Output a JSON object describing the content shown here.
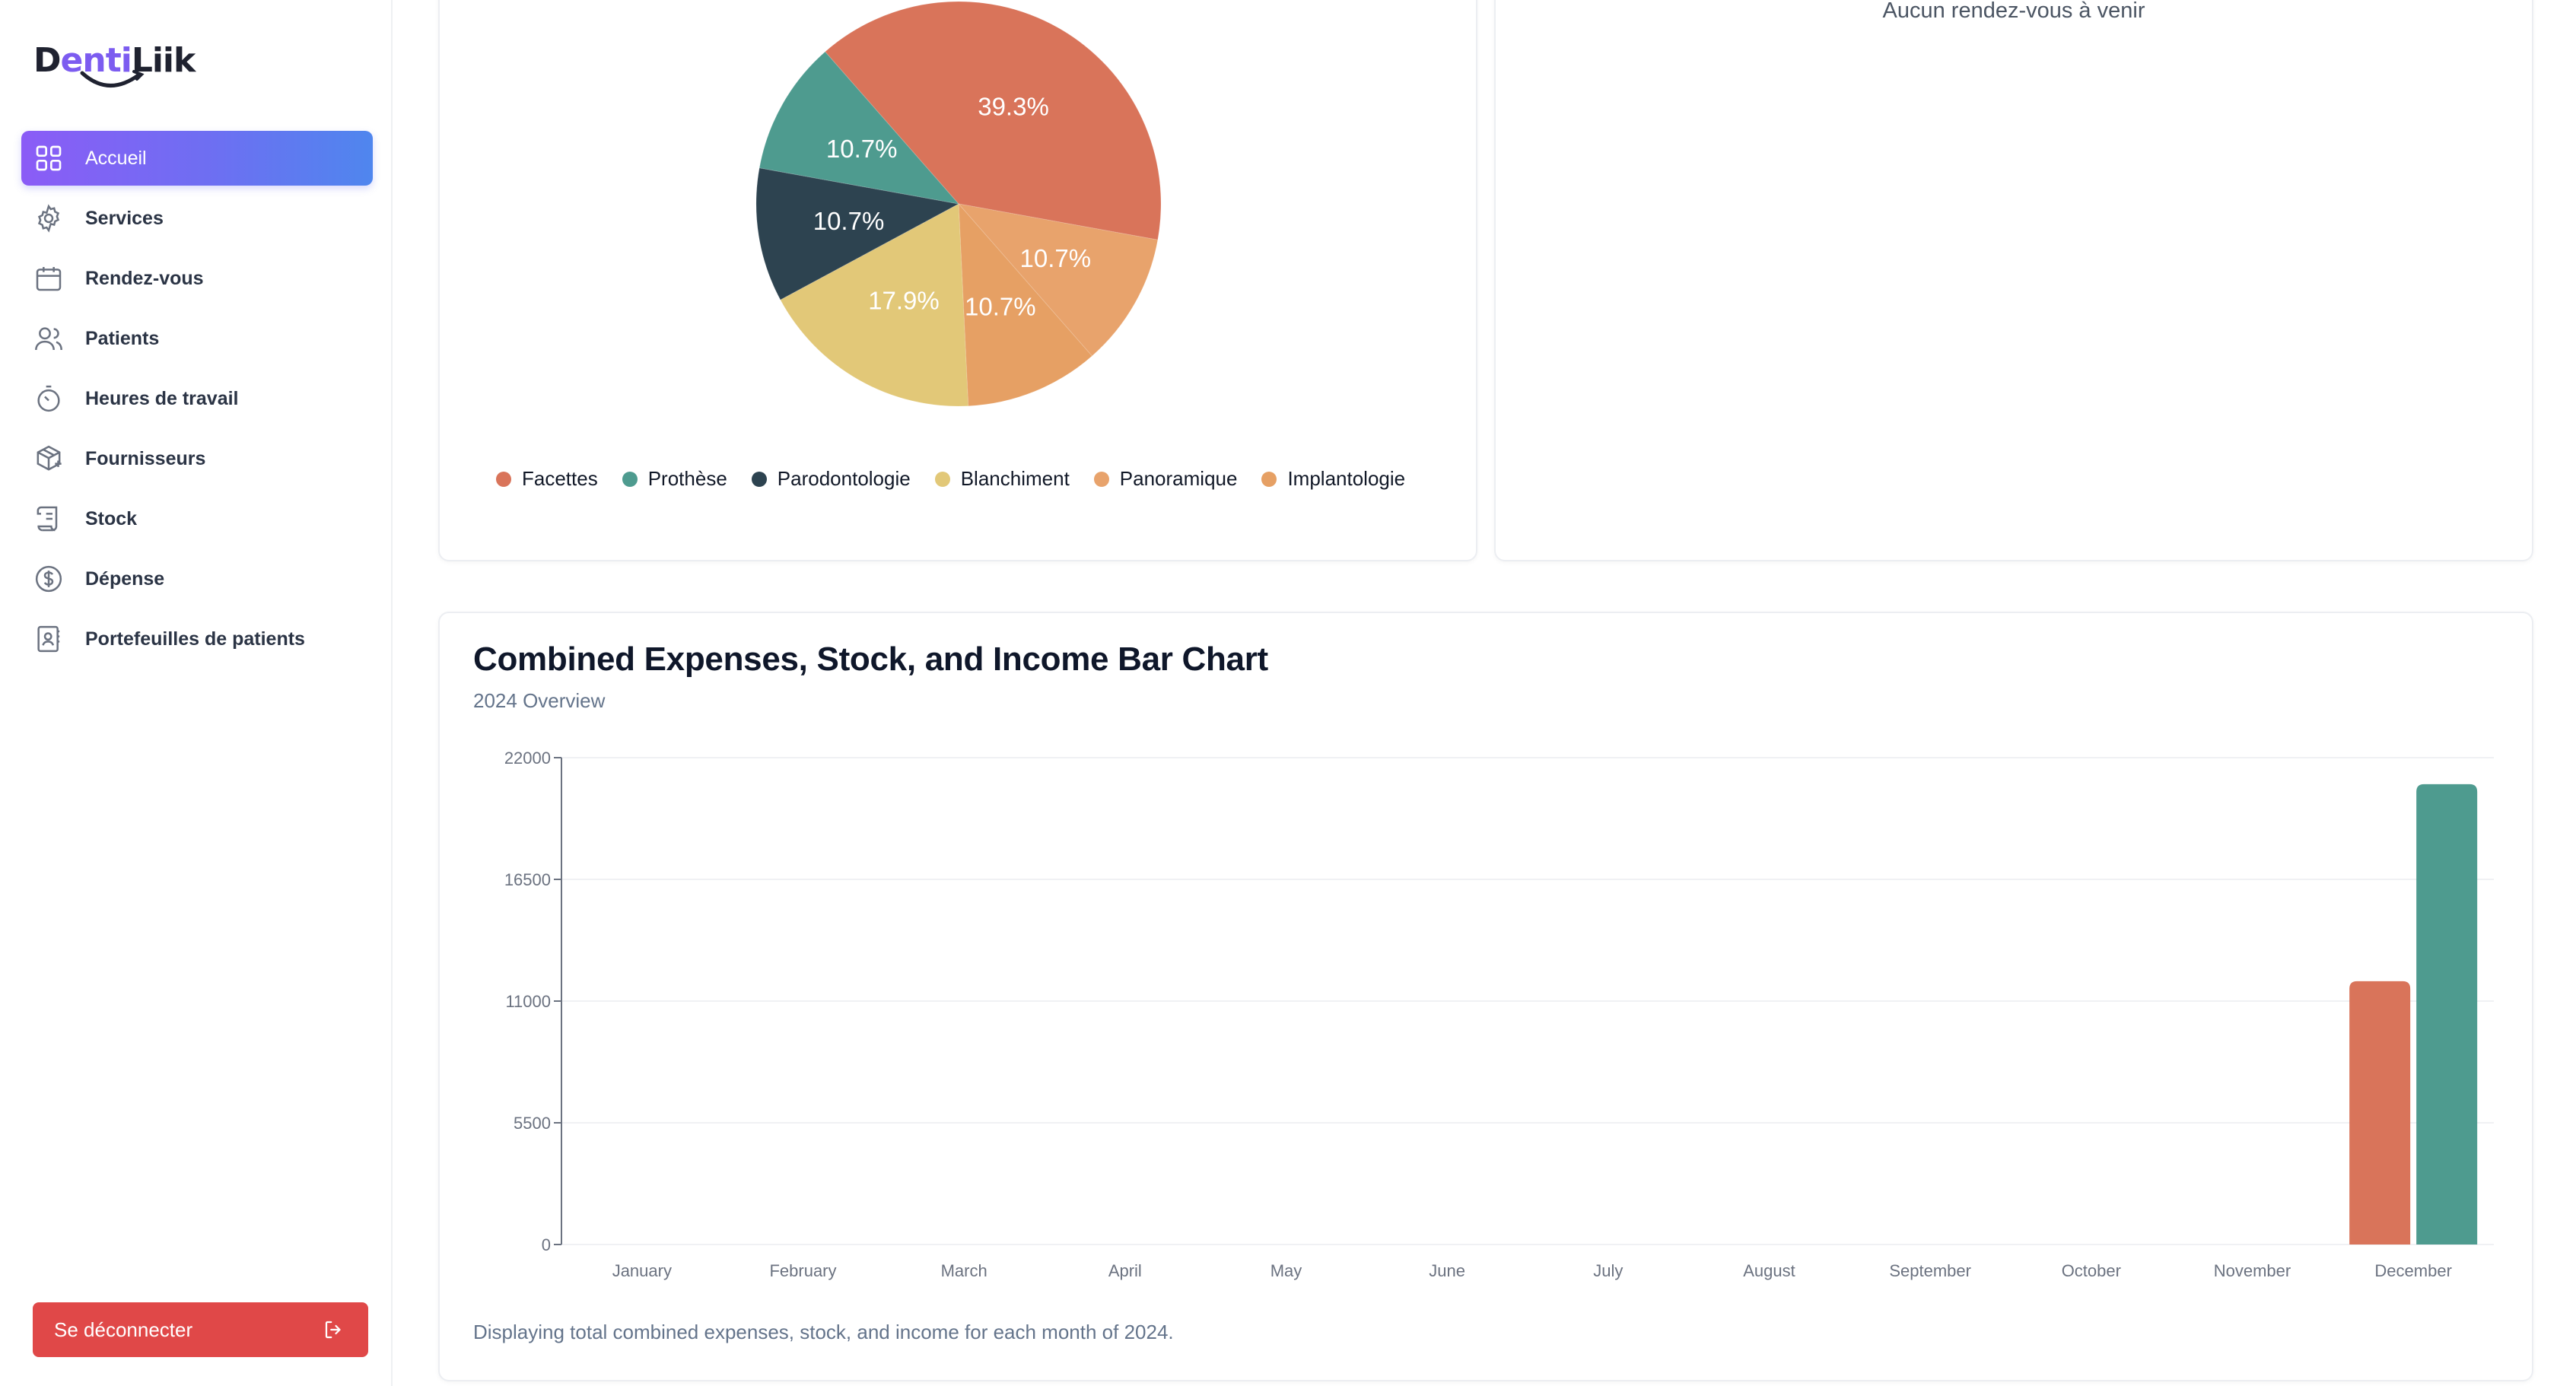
{
  "brand": {
    "logo_text_d": "D",
    "logo_text_enti": "enti",
    "logo_text_liik": "Liik"
  },
  "sidebar": {
    "items": [
      {
        "label": "Accueil",
        "icon": "grid-icon",
        "active": true
      },
      {
        "label": "Services",
        "icon": "gear-icon"
      },
      {
        "label": "Rendez-vous",
        "icon": "calendar-icon"
      },
      {
        "label": "Patients",
        "icon": "users-icon"
      },
      {
        "label": "Heures de travail",
        "icon": "timer-icon"
      },
      {
        "label": "Fournisseurs",
        "icon": "package-icon"
      },
      {
        "label": "Stock",
        "icon": "scroll-icon"
      },
      {
        "label": "Dépense",
        "icon": "dollar-circle-icon"
      },
      {
        "label": "Portefeuilles de patients",
        "icon": "contact-book-icon"
      }
    ],
    "logout_label": "Se déconnecter",
    "logout_icon": "logout-icon"
  },
  "appointments": {
    "empty_text": "Aucun rendez-vous à venir"
  },
  "colors": {
    "accent_gradient_start": "#8b5cf6",
    "accent_gradient_end": "#4f86ee",
    "logout": "#e04848",
    "facettes": "#d9745a",
    "prothese": "#4e9b8f",
    "parodontologie": "#2d4350",
    "blanchiment": "#e2c878",
    "panoramique": "#e8a36c",
    "implantologie": "#e6a064"
  },
  "chart_data": [
    {
      "type": "pie",
      "slices": [
        {
          "label": "Facettes",
          "value": 39.3,
          "display": "39.3%",
          "color": "#d9745a"
        },
        {
          "label": "Panoramique",
          "value": 10.7,
          "display": "10.7%",
          "color": "#e8a36c"
        },
        {
          "label": "Implantologie",
          "value": 10.7,
          "display": "10.7%",
          "color": "#e6a064"
        },
        {
          "label": "Blanchiment",
          "value": 17.9,
          "display": "17.9%",
          "color": "#e2c878"
        },
        {
          "label": "Parodontologie",
          "value": 10.7,
          "display": "10.7%",
          "color": "#2d4350"
        },
        {
          "label": "Prothèse",
          "value": 10.7,
          "display": "10.7%",
          "color": "#4e9b8f"
        }
      ],
      "legend": [
        "Facettes",
        "Prothèse",
        "Parodontologie",
        "Blanchiment",
        "Panoramique",
        "Implantologie"
      ],
      "legend_placement": "bottom"
    },
    {
      "type": "bar",
      "title": "Combined Expenses, Stock, and Income Bar Chart",
      "subtitle": "2024 Overview",
      "footer": "Displaying total combined expenses, stock, and income for each month of 2024.",
      "categories": [
        "January",
        "February",
        "March",
        "April",
        "May",
        "June",
        "July",
        "August",
        "September",
        "October",
        "November",
        "December"
      ],
      "series": [
        {
          "values": [
            0,
            0,
            0,
            0,
            0,
            0,
            0,
            0,
            0,
            0,
            0,
            11900
          ],
          "color": "#d9745a"
        },
        {
          "values": [
            0,
            0,
            0,
            0,
            0,
            0,
            0,
            0,
            0,
            0,
            0,
            20800
          ],
          "color": "#4e9b8f"
        }
      ],
      "ylim": [
        0,
        22000
      ],
      "yticks": [
        "0",
        "5500",
        "11000",
        "16500",
        "22000"
      ],
      "grid": true
    }
  ]
}
